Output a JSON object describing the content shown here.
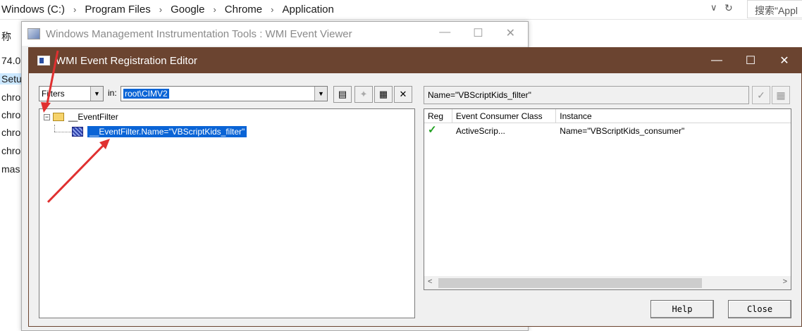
{
  "explorer": {
    "breadcrumbs": [
      "Windows (C:)",
      "Program Files",
      "Google",
      "Chrome",
      "Application"
    ],
    "search_placeholder": "搜索\"Appl",
    "sidebar_items": [
      "称",
      "74.0.",
      "Setu",
      "chro",
      "chro",
      "chro",
      "chro",
      "mas"
    ]
  },
  "viewer": {
    "title": "Windows Management Instrumentation Tools : WMI Event Viewer"
  },
  "editor": {
    "title": "WMI Event Registration Editor",
    "type_combo_value": "Filters",
    "in_label": "in:",
    "namespace_value": "root\\CIMV2",
    "tree": {
      "root_label": "__EventFilter",
      "expander": "−",
      "child_label": "__EventFilter.Name=\"VBScriptKids_filter\""
    },
    "filter_path": "Name=\"VBScriptKids_filter\"",
    "consumer_list": {
      "columns": [
        "Reg",
        "Event Consumer Class",
        "Instance"
      ],
      "rows": [
        {
          "reg": "✓",
          "class": "ActiveScrip...",
          "instance": "Name=\"VBScriptKids_consumer\""
        }
      ]
    },
    "help_label": "Help",
    "close_label": "Close"
  },
  "colors": {
    "editor_titlebar": "#6b4430",
    "selection": "#0a64d6",
    "annotation_arrow": "#e03030",
    "check": "#20a020"
  }
}
